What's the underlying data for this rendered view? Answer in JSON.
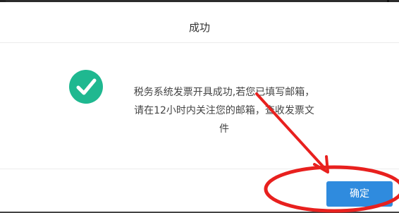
{
  "dialog": {
    "title": "成功",
    "message_line1": "税务系统发票开具成功,若您已填写邮箱，",
    "message_line2": "请在12小时内关注您的邮箱，查收发票文",
    "message_line3": "件",
    "confirm_label": "确定"
  },
  "icons": {
    "success": "check-circle-icon"
  },
  "colors": {
    "success_green": "#1fb890",
    "button_blue": "#2f8bde",
    "annotation_red": "#e8201e"
  }
}
